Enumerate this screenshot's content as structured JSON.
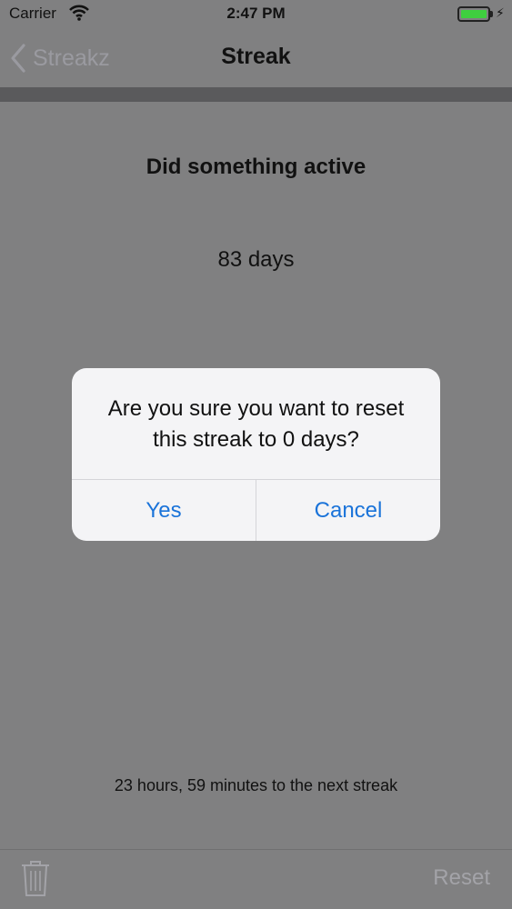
{
  "status_bar": {
    "carrier": "Carrier",
    "time": "2:47 PM",
    "battery_color": "#3fcf3f"
  },
  "nav": {
    "back_label": "Streakz",
    "title": "Streak"
  },
  "streak": {
    "name": "Did something active",
    "count": "83 days",
    "next_streak": "23 hours, 59 minutes to the next streak"
  },
  "toolbar": {
    "trash_icon": "trash-icon",
    "reset_label": "Reset"
  },
  "alert": {
    "message": "Are you sure you want to reset this streak to 0 days?",
    "yes_label": "Yes",
    "cancel_label": "Cancel",
    "button_color": "#1a73d9"
  }
}
